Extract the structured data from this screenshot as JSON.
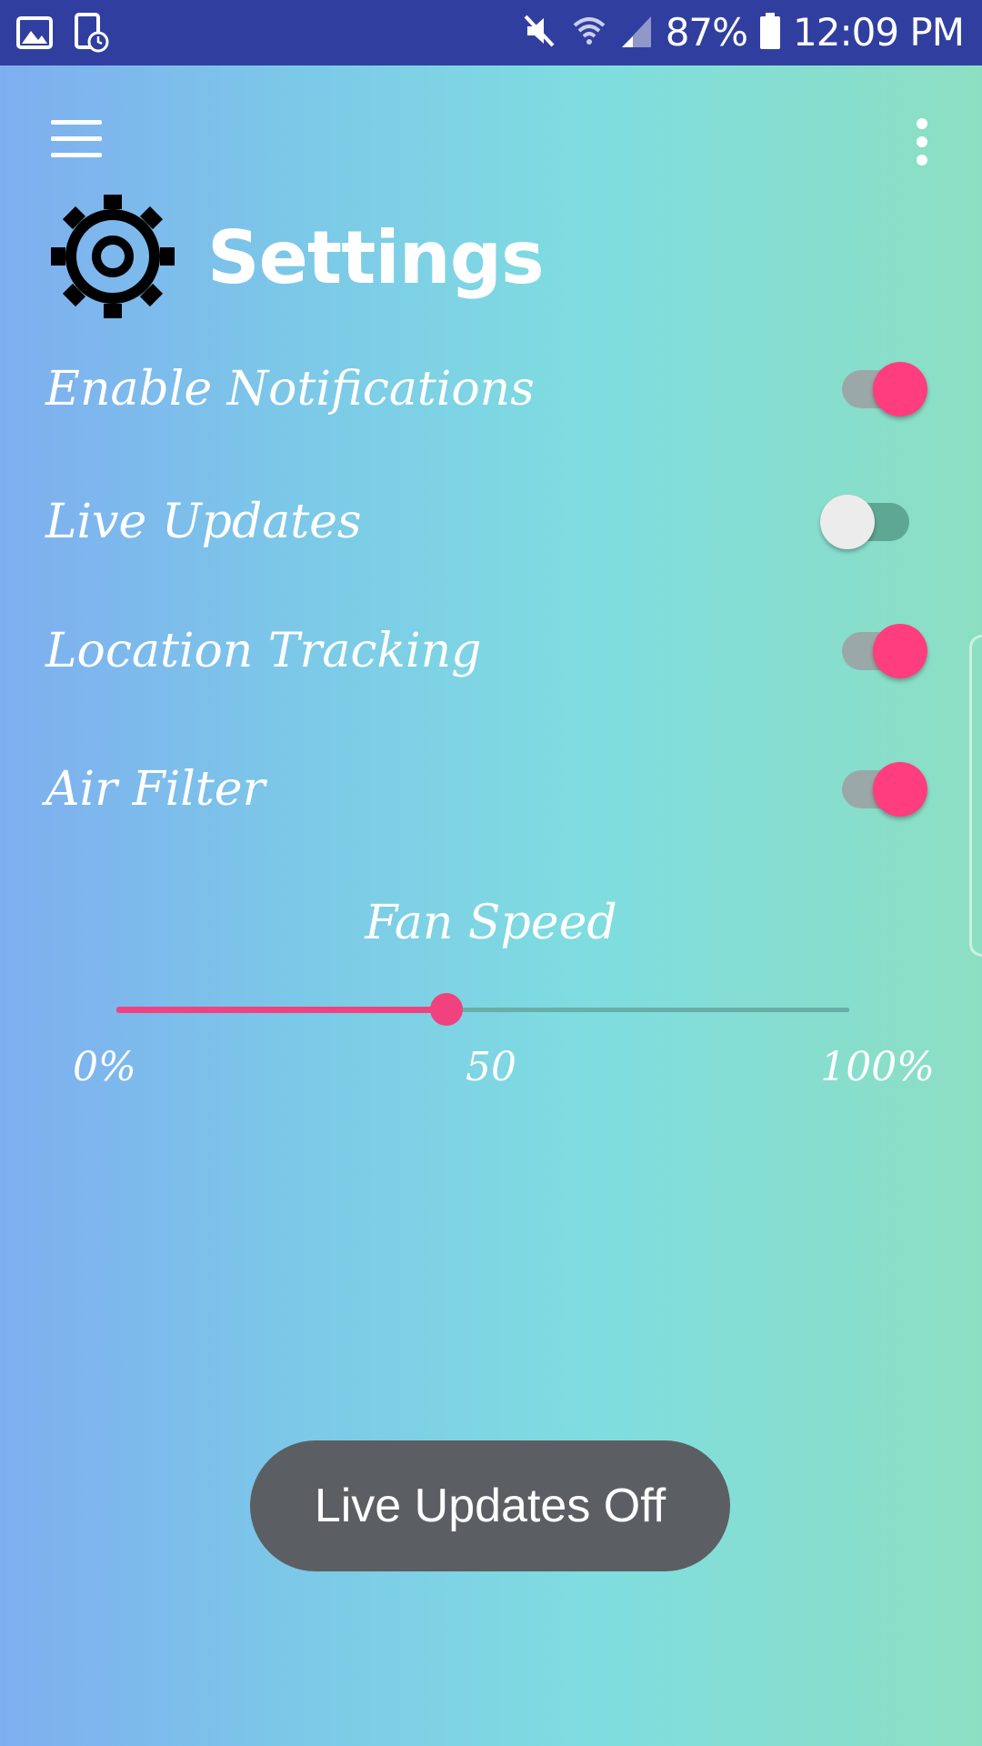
{
  "status_bar": {
    "battery_percent": "87%",
    "time": "12:09 PM",
    "icons": [
      "image-icon",
      "screen-timer-icon",
      "mute-icon",
      "wifi-icon",
      "signal-icon",
      "battery-icon"
    ]
  },
  "toolbar": {
    "menu_icon": "menu-icon",
    "overflow_icon": "more-vert-icon"
  },
  "header": {
    "icon": "gear-icon",
    "title": "Settings"
  },
  "settings": [
    {
      "label": "Enable Notifications",
      "checked": true
    },
    {
      "label": "Live Updates",
      "checked": false
    },
    {
      "label": "Location Tracking",
      "checked": true
    },
    {
      "label": "Air Filter",
      "checked": true
    }
  ],
  "fan_speed": {
    "label": "Fan Speed",
    "value_percent": 45,
    "min_label": "0%",
    "mid_label": "50",
    "max_label": "100%"
  },
  "toast": {
    "message": "Live Updates Off"
  },
  "colors": {
    "status_bar": "#303f9f",
    "accent": "#ff3d7f",
    "gradient_start": "#7eaef0",
    "gradient_end": "#8ddfc2",
    "toast_bg": "#5b5f63"
  }
}
